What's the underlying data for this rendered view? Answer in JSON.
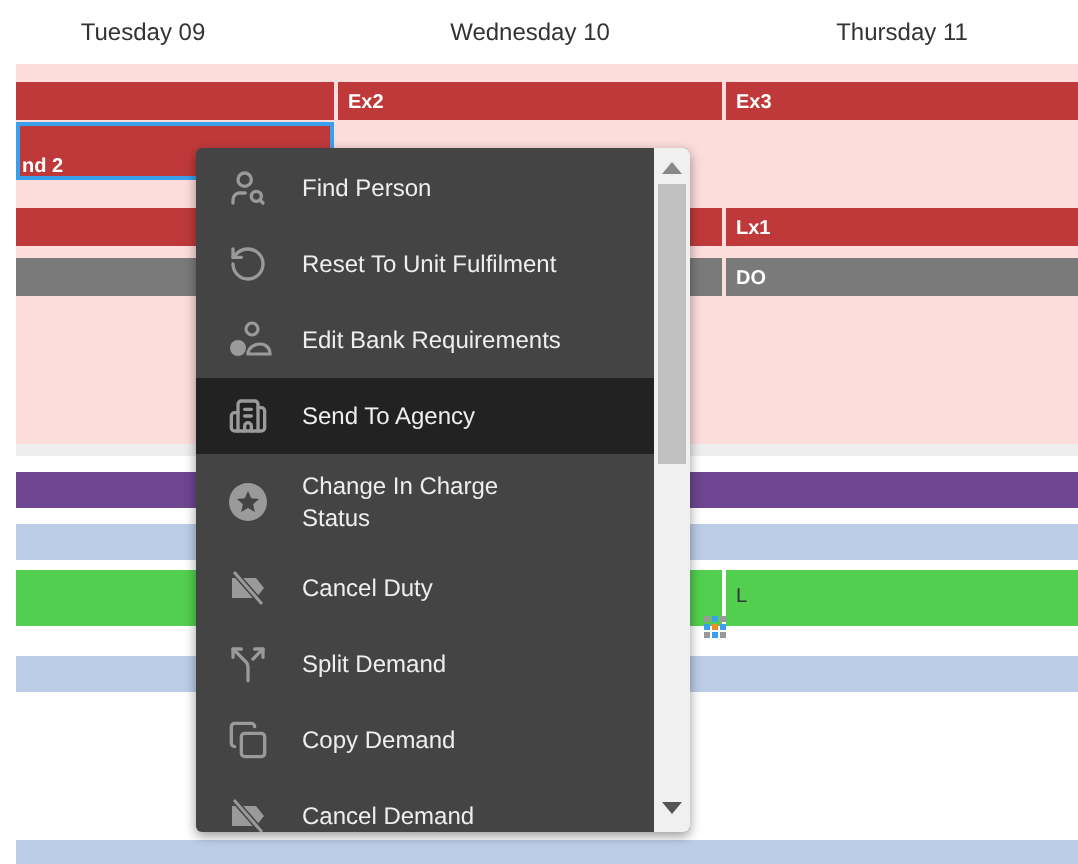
{
  "day_headers": [
    "Tuesday 09",
    "Wednesday 10",
    "Thursday 11"
  ],
  "band_lanes": [
    {
      "cells": [
        {
          "color": "#c0393a",
          "selected": false
        },
        {
          "color": "#c0393a",
          "label": "Ex2",
          "selected": false
        },
        {
          "color": "#c0393a",
          "label": "Ex3",
          "selected": false
        }
      ]
    },
    {
      "cells": [
        {
          "color": "#c0393a",
          "label": "nd 2",
          "selected": true
        },
        {
          "selected": false
        },
        {
          "selected": false
        }
      ]
    },
    {
      "cells": [
        {
          "color": "#c0393a",
          "selected": false
        },
        {
          "color": "#c0393a",
          "selected": false
        },
        {
          "color": "#c0393a",
          "label": "Lx1",
          "selected": false
        }
      ]
    },
    {
      "cells": [
        {
          "color": "#7a7a7a",
          "selected": false
        },
        {
          "color": "#7a7a7a",
          "selected": false
        },
        {
          "color": "#7a7a7a",
          "label": "DO",
          "selected": false
        }
      ]
    }
  ],
  "lanes": [
    {
      "color": "#6e4590"
    },
    {
      "color": "#bccde8"
    },
    {
      "color": "#52cf4e",
      "cells": [
        {
          "selected": false
        },
        {
          "selected": false
        },
        {
          "label": "L",
          "selected": false
        }
      ]
    },
    {
      "color": "#bccde8"
    }
  ],
  "bottom_lane": {
    "color": "#bccde8"
  },
  "context_menu": {
    "items": [
      {
        "label": "Find Person",
        "selected": false
      },
      {
        "label": "Reset To Unit Fulfilment",
        "selected": false
      },
      {
        "label": "Edit Bank Requirements",
        "selected": false
      },
      {
        "label": "Send To Agency",
        "selected": true
      },
      {
        "label": "Change In Charge Status",
        "selected": false
      },
      {
        "label": "Cancel Duty",
        "selected": false
      },
      {
        "label": "Split Demand",
        "selected": false
      },
      {
        "label": "Copy Demand",
        "selected": false
      },
      {
        "label": "Cancel Demand",
        "selected": false
      }
    ]
  }
}
